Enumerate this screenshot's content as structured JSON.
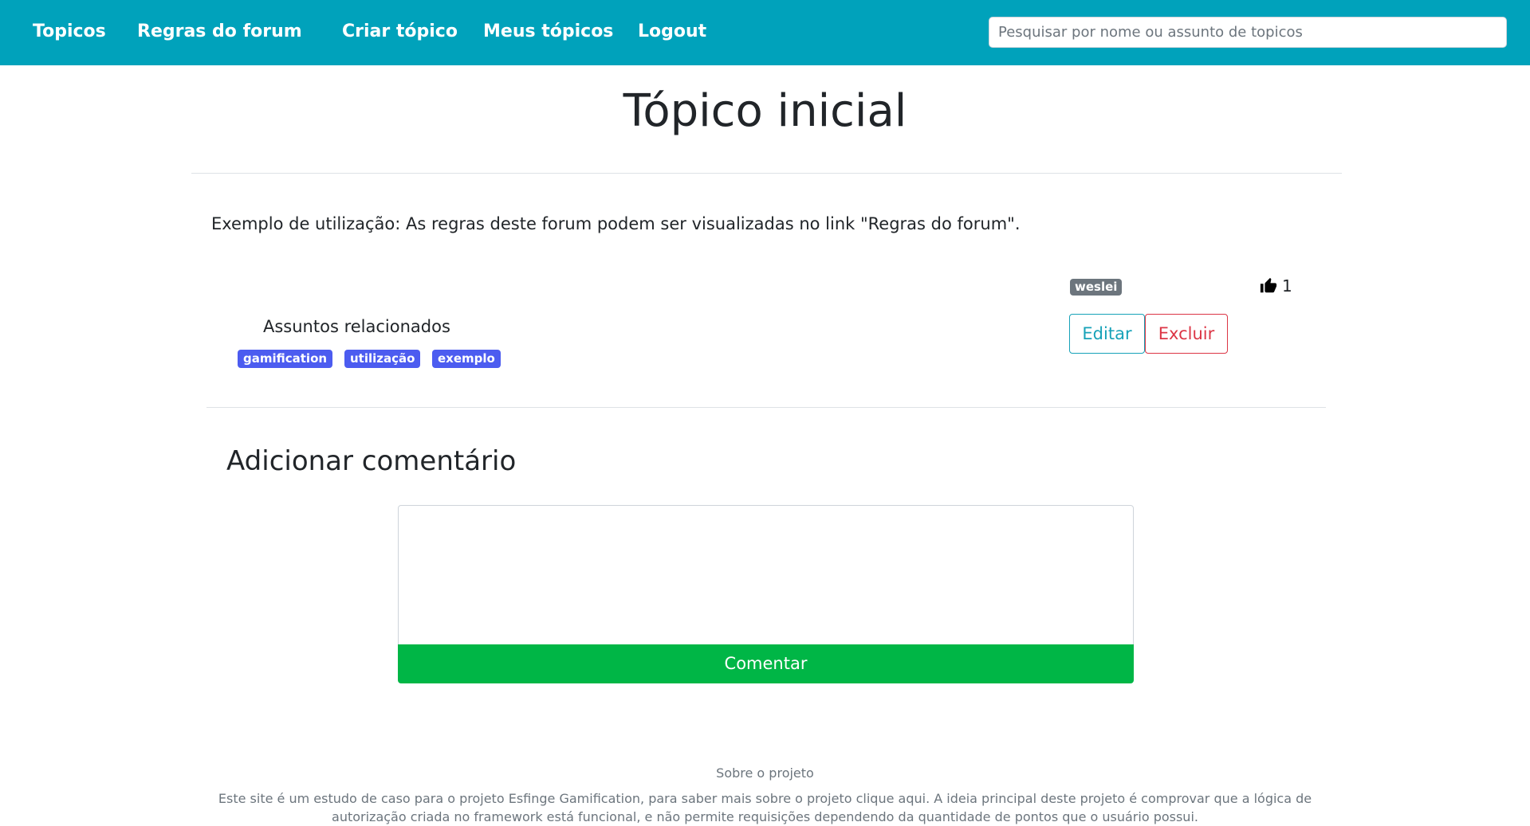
{
  "nav": {
    "items": [
      {
        "label": "Topicos"
      },
      {
        "label": "Regras do forum"
      },
      {
        "label": "Criar tópico"
      },
      {
        "label": "Meus tópicos"
      },
      {
        "label": "Logout"
      }
    ],
    "search_placeholder": "Pesquisar por nome ou assunto de topicos"
  },
  "topic": {
    "title": "Tópico inicial",
    "body": "Exemplo de utilização: As regras deste forum podem ser visualizadas no link \"Regras do forum\".",
    "author": "weslei",
    "likes": "1",
    "related_title": "Assuntos relacionados",
    "tags": [
      "gamification",
      "utilização",
      "exemplo"
    ],
    "edit_label": "Editar",
    "delete_label": "Excluir"
  },
  "comment": {
    "section_title": "Adicionar comentário",
    "input_value": "",
    "submit_label": "Comentar"
  },
  "footer": {
    "title": "Sobre o projeto",
    "text": "Este site é um estudo de caso para o projeto Esfinge Gamification, para saber mais sobre o projeto clique aqui. A ideia principal deste projeto é comprovar que a lógica de autorização criada no framework está funcional, e não permite requisições dependendo da quantidade de pontos que o usuário possui."
  },
  "colors": {
    "navbar": "#00a2bb",
    "tag": "#4c5cf0",
    "badge": "#6c757d",
    "edit": "#17a2b8",
    "delete": "#dc3545",
    "submit": "#00b646"
  },
  "icons": {
    "like": "thumbs-up-icon"
  }
}
